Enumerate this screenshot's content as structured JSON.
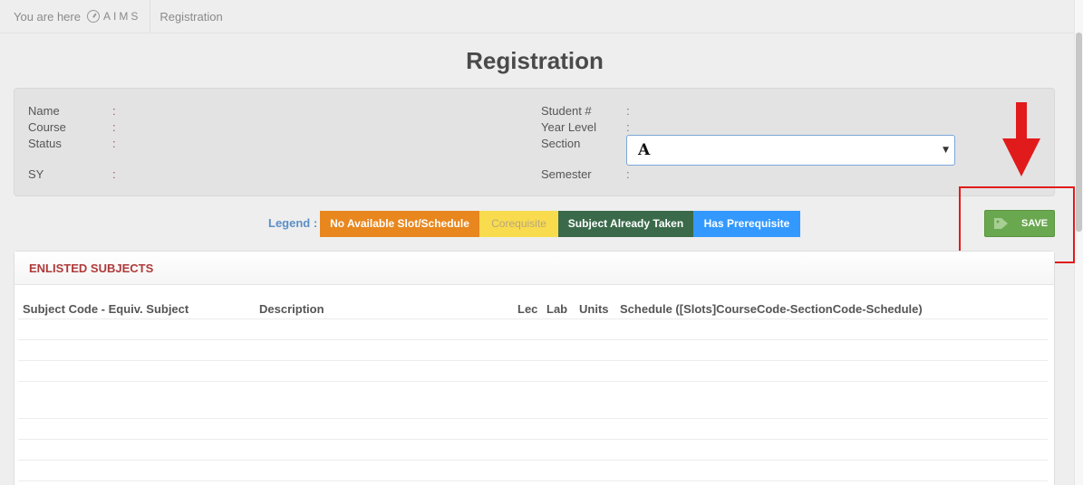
{
  "breadcrumb": {
    "prefix": "You are here",
    "home": "AIMS",
    "current": "Registration"
  },
  "page": {
    "title": "Registration"
  },
  "student_info": {
    "name_label": "Name",
    "course_label": "Course",
    "status_label": "Status",
    "sy_label": "SY",
    "student_no_label": "Student #",
    "year_level_label": "Year Level",
    "section_label": "Section",
    "semester_label": "Semester",
    "colon": ":",
    "section_value": "A"
  },
  "legend": {
    "label": "Legend :",
    "items": [
      {
        "label": "No Available Slot/Schedule",
        "color": "#e8871e"
      },
      {
        "label": "Corequisite",
        "color": "#f9dc4e"
      },
      {
        "label": "Subject Already Taken",
        "color": "#3a6a4a"
      },
      {
        "label": "Has Prerequisite",
        "color": "#3399ff"
      }
    ]
  },
  "actions": {
    "save_label": "SAVE",
    "save_color": "#6aa84f",
    "annotation_color": "#e11b1b"
  },
  "enlisted": {
    "title": "ENLISTED SUBJECTS",
    "columns": [
      "Subject Code - Equiv. Subject",
      "Description",
      "Lec",
      "Lab",
      "Units",
      "Schedule ([Slots]CourseCode-SectionCode-Schedule)"
    ],
    "rows": []
  }
}
